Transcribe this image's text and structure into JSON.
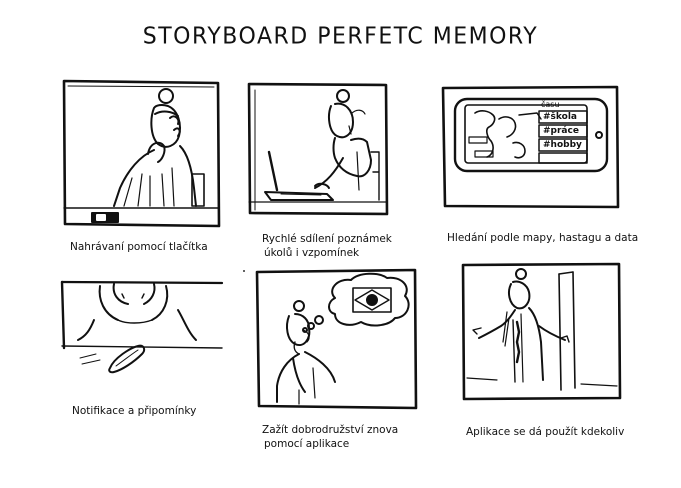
{
  "title": "STORYBOARD PERFETC MEMORY",
  "captions": {
    "p1": "Nahrávaní pomocí tlačítka",
    "p2_line1": "Rychlé sdílení poznámek",
    "p2_line2": "úkolů i vzpomínek",
    "p3": "Hledání podle mapy, hastagu a data",
    "p4": "Notifikace a připomínky",
    "p5_line1": "Zažít dobrodružství znova",
    "p5_line2": "pomocí aplikace",
    "p6": "Aplikace se dá použít kdekoliv"
  },
  "phone_tags": [
    "#škola",
    "#práce",
    "#hobby"
  ],
  "phone_top_label": "času",
  "ink_color": "#111111"
}
